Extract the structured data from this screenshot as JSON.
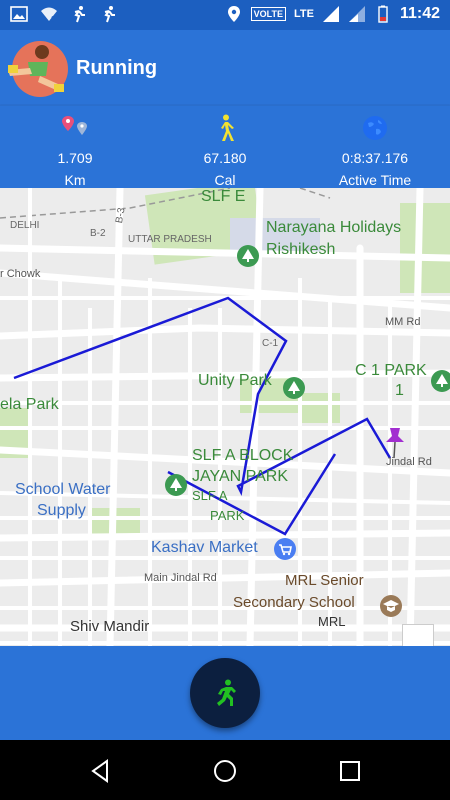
{
  "status_bar": {
    "volte": "VOLTE",
    "lte": "LTE",
    "time": "11:42"
  },
  "app_bar": {
    "title": "Running"
  },
  "stats": [
    {
      "value": "1.709",
      "label": "Km",
      "icon": "location-pins-icon"
    },
    {
      "value": "67.180",
      "label": "Cal",
      "icon": "walking-person-icon"
    },
    {
      "value": "0:8:37.176",
      "label": "Active Time",
      "icon": "globe-icon"
    }
  ],
  "map": {
    "labels": {
      "slf_e": "SLF E",
      "narayana": "Narayana Holidays",
      "rishikesh": "Rishikesh",
      "delhi": "DELHI",
      "b3": "B-3",
      "b2": "B-2",
      "uttar_pradesh": "UTTAR PRADESH",
      "chowk": "r Chowk",
      "mm_rd": "MM Rd",
      "c1": "C-1",
      "c1_park_1": "C 1 PARK",
      "c1_park_2": "1",
      "unity_park": "Unity Park",
      "ela_park": "ela Park",
      "slf_a_block_1": "SLF A BLOCK",
      "slf_a_block_2": "JAYAN PARK",
      "slf_a_park_1": "SLF A",
      "slf_a_park_2": "PARK",
      "jindal_rd": "Jindal Rd",
      "school_water_1": "School Water",
      "school_water_2": "Supply",
      "kashav_market": "Kashav Market",
      "main_jindal_rd": "Main Jindal Rd",
      "mrl_1": "MRL Senior",
      "mrl_2": "Secondary School",
      "mrl_3": "MRL",
      "shiv_mandir": "Shiv Mandir"
    },
    "route_color": "#1a1ad6"
  },
  "colors": {
    "primary": "#2b73d7",
    "status": "#1c5fc0",
    "fab": "#0c1f3f",
    "run_green": "#22c022"
  }
}
